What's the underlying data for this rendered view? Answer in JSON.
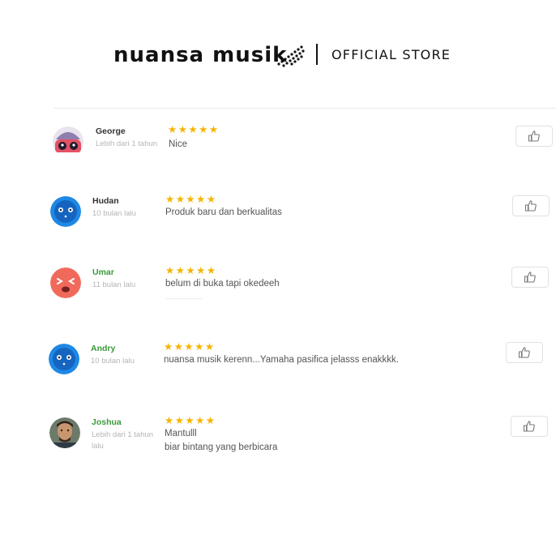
{
  "header": {
    "brand": "nuansa musik",
    "store_label": "OFFICIAL STORE"
  },
  "colors": {
    "star": "#f6b400",
    "name_green": "#3a9a3a",
    "avatar_blue": "#1e88e5",
    "avatar_red": "#f06a5c"
  },
  "reviews": [
    {
      "name": "George",
      "time": "Lebih dari 1 tahun",
      "rating": 5,
      "stars": "★★★★★",
      "text": "Nice",
      "avatar_icon": "robot-avatar-icon"
    },
    {
      "name": "Hudan",
      "time": "10 bulan lalu",
      "rating": 5,
      "stars": "★★★★★",
      "text": "Produk baru dan berkualitas",
      "avatar_icon": "blue-face-avatar-icon"
    },
    {
      "name": "Umar",
      "time": "11 bulan lalu",
      "rating": 5,
      "stars": "★★★★★",
      "text": "belum di buka tapi okedeeh",
      "avatar_icon": "red-face-avatar-icon"
    },
    {
      "name": "Andry",
      "time": "10 bulan lalu",
      "rating": 5,
      "stars": "★★★★★",
      "text": "nuansa musik kerenn...Yamaha pasifica jelasss enakkkk.",
      "avatar_icon": "blue-face-avatar-icon"
    },
    {
      "name": "Joshua",
      "time": "Lebih dari 1 tahun lalu",
      "rating": 5,
      "stars": "★★★★★",
      "text": "Mantulll",
      "text2": "biar bintang yang berbicara",
      "avatar_icon": "user-photo-avatar"
    }
  ]
}
